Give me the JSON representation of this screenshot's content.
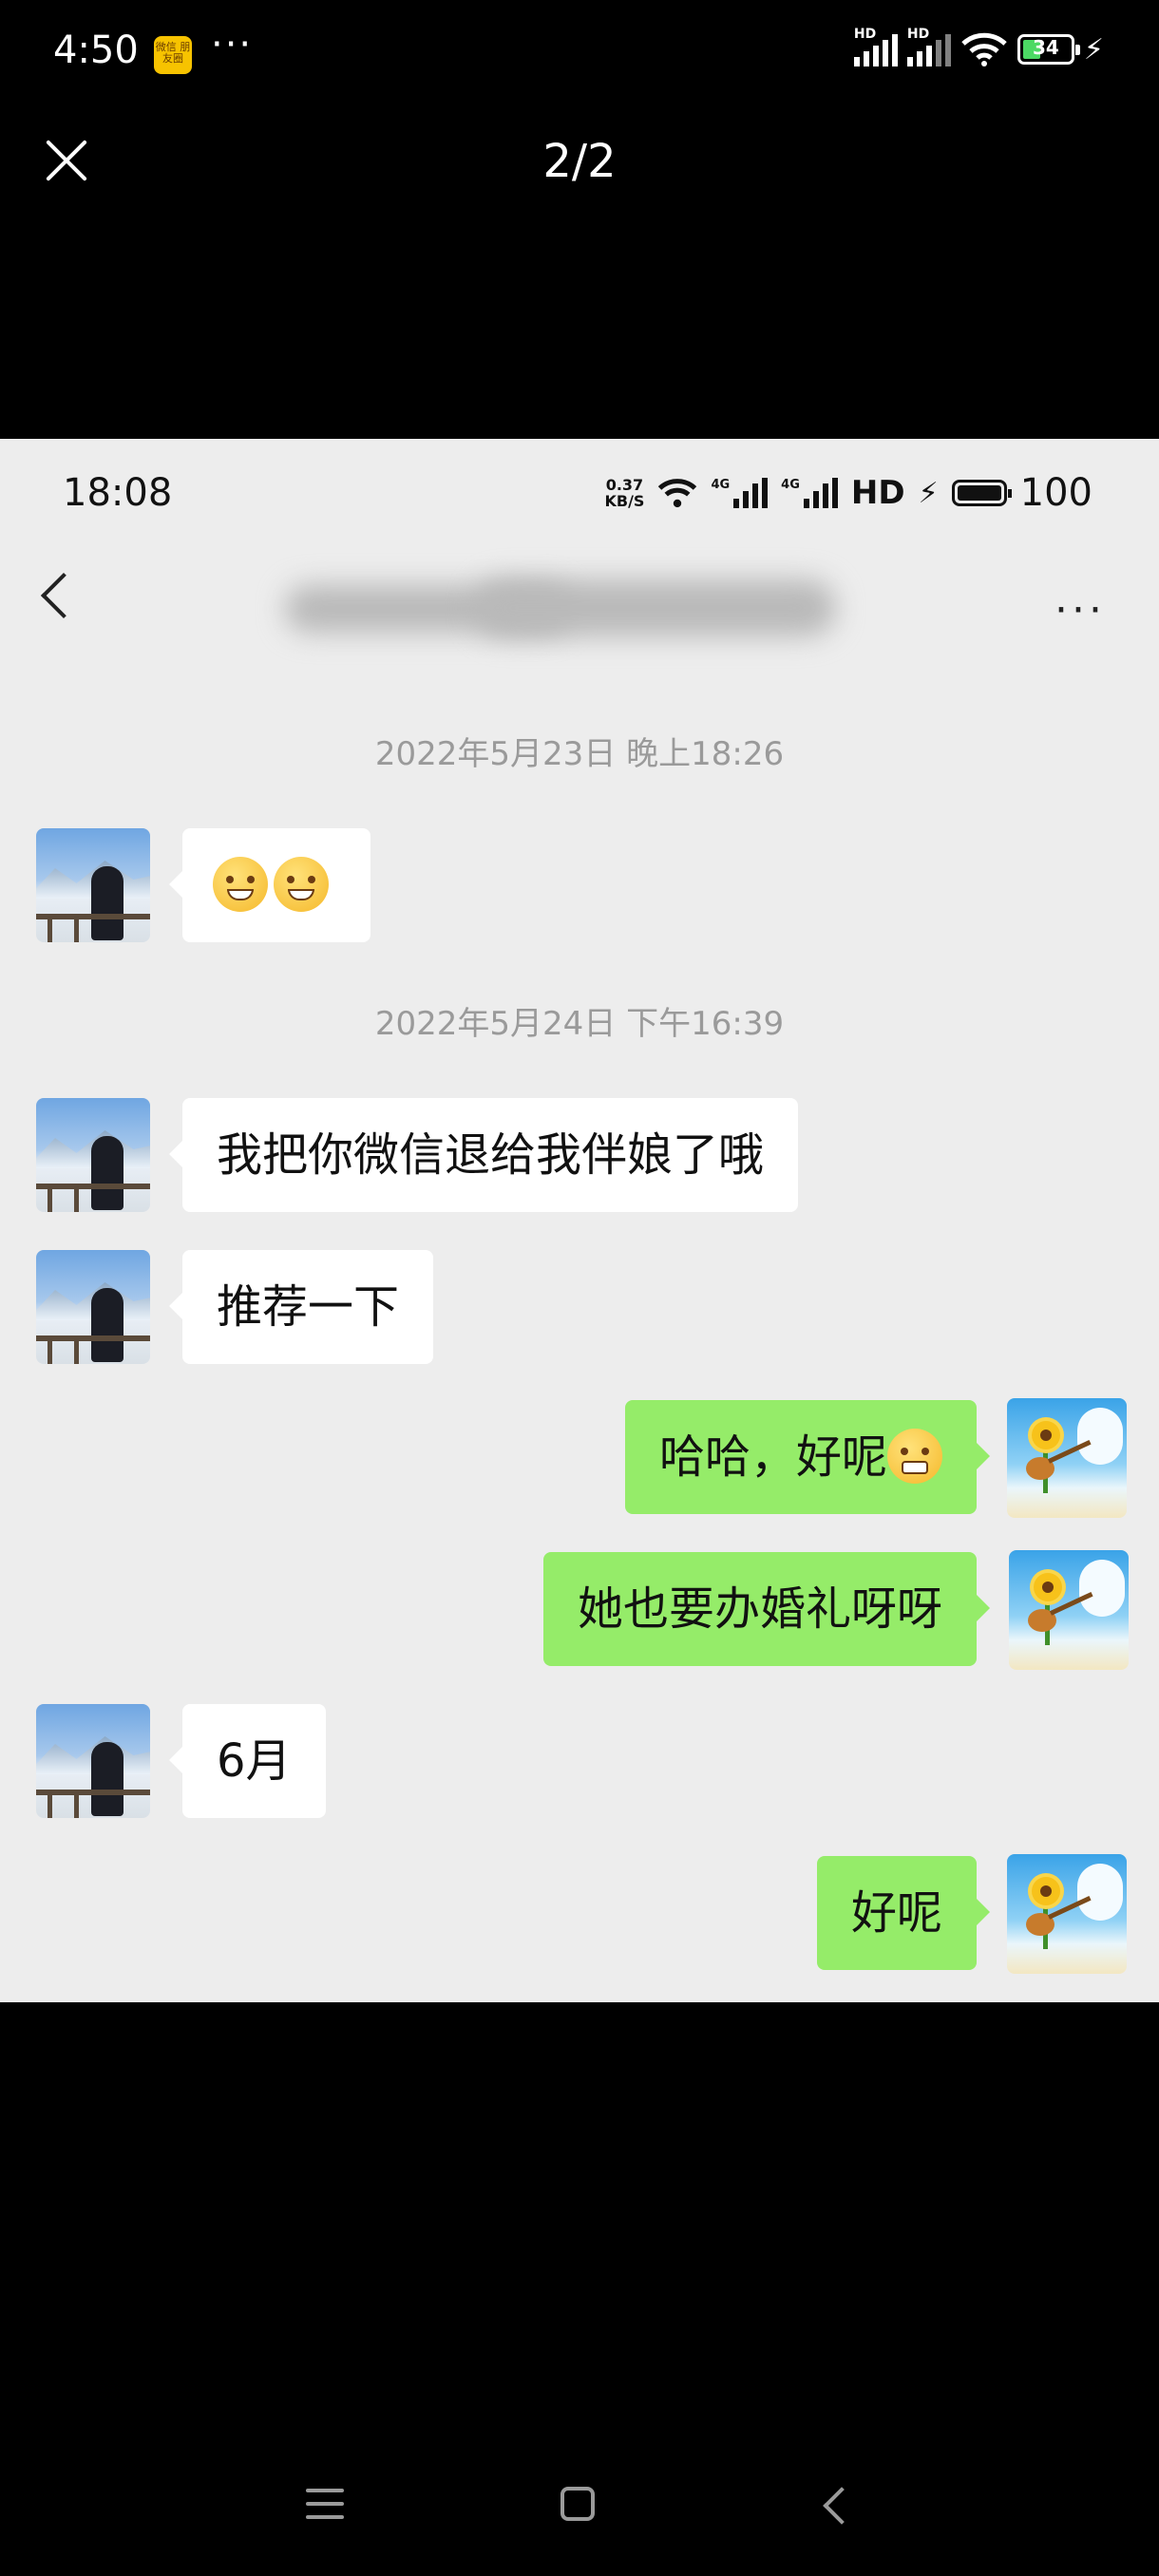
{
  "status_bar": {
    "time": "4:50",
    "app_icon_label": "微信 朋友圈",
    "more": "···",
    "hd1": "HD",
    "hd2": "HD",
    "battery": "34"
  },
  "viewer": {
    "counter": "2/2"
  },
  "inner": {
    "status_bar": {
      "time": "18:08",
      "speed_value": "0.37",
      "speed_unit": "KB/S",
      "net1": "4G",
      "net2": "4G",
      "hd": "HD",
      "battery": "100"
    },
    "nav": {
      "more": "···"
    },
    "timestamps": [
      "2022年5月23日 晚上18:26",
      "2022年5月24日 下午16:39"
    ],
    "messages": [
      {
        "side": "left",
        "text": "",
        "emoji": [
          "hug-emoji",
          "hug-emoji"
        ]
      },
      {
        "side": "left",
        "text": "我把你微信退给我伴娘了哦"
      },
      {
        "side": "left",
        "text": "推荐一下"
      },
      {
        "side": "right",
        "text": "哈哈，好呢",
        "emoji": [
          "grin-emoji"
        ]
      },
      {
        "side": "right",
        "text": "她也要办婚礼呀呀"
      },
      {
        "side": "left",
        "text": "6月"
      },
      {
        "side": "right",
        "text": "好呢"
      }
    ]
  },
  "colors": {
    "sent_bubble": "#95ec69",
    "received_bubble": "#ffffff",
    "chat_bg": "#ededed"
  }
}
